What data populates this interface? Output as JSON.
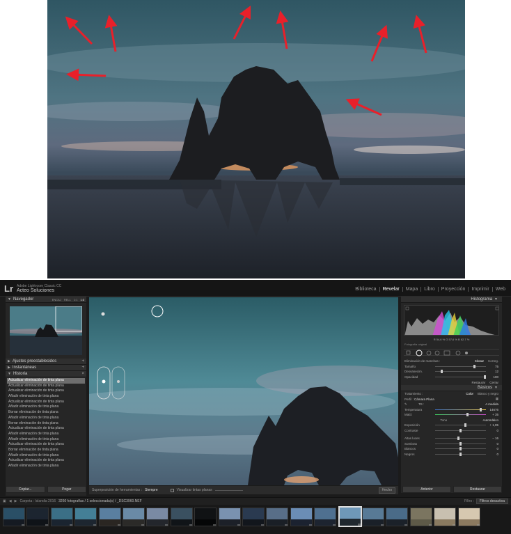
{
  "lightroom": {
    "logo": "Lr",
    "product": "Adobe Lightroom Classic CC",
    "identity": "Acteo Soluciones",
    "modules": [
      "Biblioteca",
      "Revelar",
      "Mapa",
      "Libro",
      "Proyección",
      "Imprimir",
      "Web"
    ],
    "active_module": "Revelar"
  },
  "left_panel": {
    "navigator_title": "Navegador",
    "navigator_options": [
      "ENCAJ",
      "RELL",
      "1:1",
      "1:3"
    ],
    "presets_title": "Ajustes preestablecidos",
    "snapshots_title": "Instantáneas",
    "history_title": "Historia",
    "history": [
      "Actualizar eliminación de tinta plana",
      "Actualizar eliminación de tinta plana",
      "Actualizar eliminación de tinta plana",
      "Añadir eliminación de tinta plana",
      "Actualizar eliminación de tinta plana",
      "Añadir eliminación de tinta plana",
      "Borrar eliminación de tinta plana",
      "Añadir eliminación de tinta plana",
      "Borrar eliminación de tinta plana",
      "Actualizar eliminación de tinta plana",
      "Añadir eliminación de tinta plana",
      "Añadir eliminación de tinta plana",
      "Actualizar eliminación de tinta plana",
      "Borrar eliminación de tinta plana",
      "Añadir eliminación de tinta plana",
      "Actualizar eliminación de tinta plana",
      "Añadir eliminación de tinta plana"
    ],
    "copy_button": "Copiar...",
    "paste_button": "Pegar"
  },
  "center_toolbar": {
    "overlay_label": "Superposición de herramientas :",
    "overlay_value": "Siempre",
    "visualize_label": "Visualizar tintas planas",
    "done_button": "Hecho"
  },
  "right_panel": {
    "histogram_title": "Histograma",
    "readout": "R  54,6  %    G  57,6  %    B  62,7  %",
    "original_photo": "Fotografía original",
    "spot_removal_title": "Eliminación de manchas :",
    "clone_label": "Clonar",
    "heal_label": "Correg.",
    "sliders_spot": [
      {
        "label": "Tamaño",
        "value": "75",
        "level": 0.78
      },
      {
        "label": "Desvanecim.",
        "value": "12",
        "level": 0.12
      },
      {
        "label": "Opacidad",
        "value": "100",
        "level": 1.0
      }
    ],
    "reset_label": "Restaurar",
    "close_label": "Cerrar",
    "basics_title": "Básicos",
    "treatment_label": "Tratamiento :",
    "treatment_color": "Color",
    "treatment_bw": "Blanco y negro",
    "profile_label": "Perfil :",
    "profile_value": "Cámara Plana",
    "wb_label": "TB :",
    "wb_value": "A medida",
    "temperature_label": "Temperatura",
    "temperature_value": "14676",
    "tint_label": "Matiz",
    "tint_value": "+ 35",
    "tone_label": "Tono",
    "auto_label": "Automático",
    "sliders_tone": [
      {
        "label": "Exposición",
        "value": "+ 1,05",
        "level": 0.6
      },
      {
        "label": "Contraste",
        "value": "0",
        "level": 0.5
      }
    ],
    "sliders_presence": [
      {
        "label": "Altas luces",
        "value": "− 16",
        "level": 0.46
      },
      {
        "label": "Sombras",
        "value": "0",
        "level": 0.5
      },
      {
        "label": "Blancos",
        "value": "0",
        "level": 0.5
      },
      {
        "label": "Negros",
        "value": "0",
        "level": 0.5
      }
    ],
    "previous_button": "Anterior",
    "restore_button": "Restaurar"
  },
  "filmstrip": {
    "folder": "Carpeta : Islandia 2016",
    "count": "3260 fotografías / 1 seleccionada(s) / _DSC3960.NEF",
    "filter_label": "Filtro :",
    "filter_value": "Filtros desactiva"
  }
}
